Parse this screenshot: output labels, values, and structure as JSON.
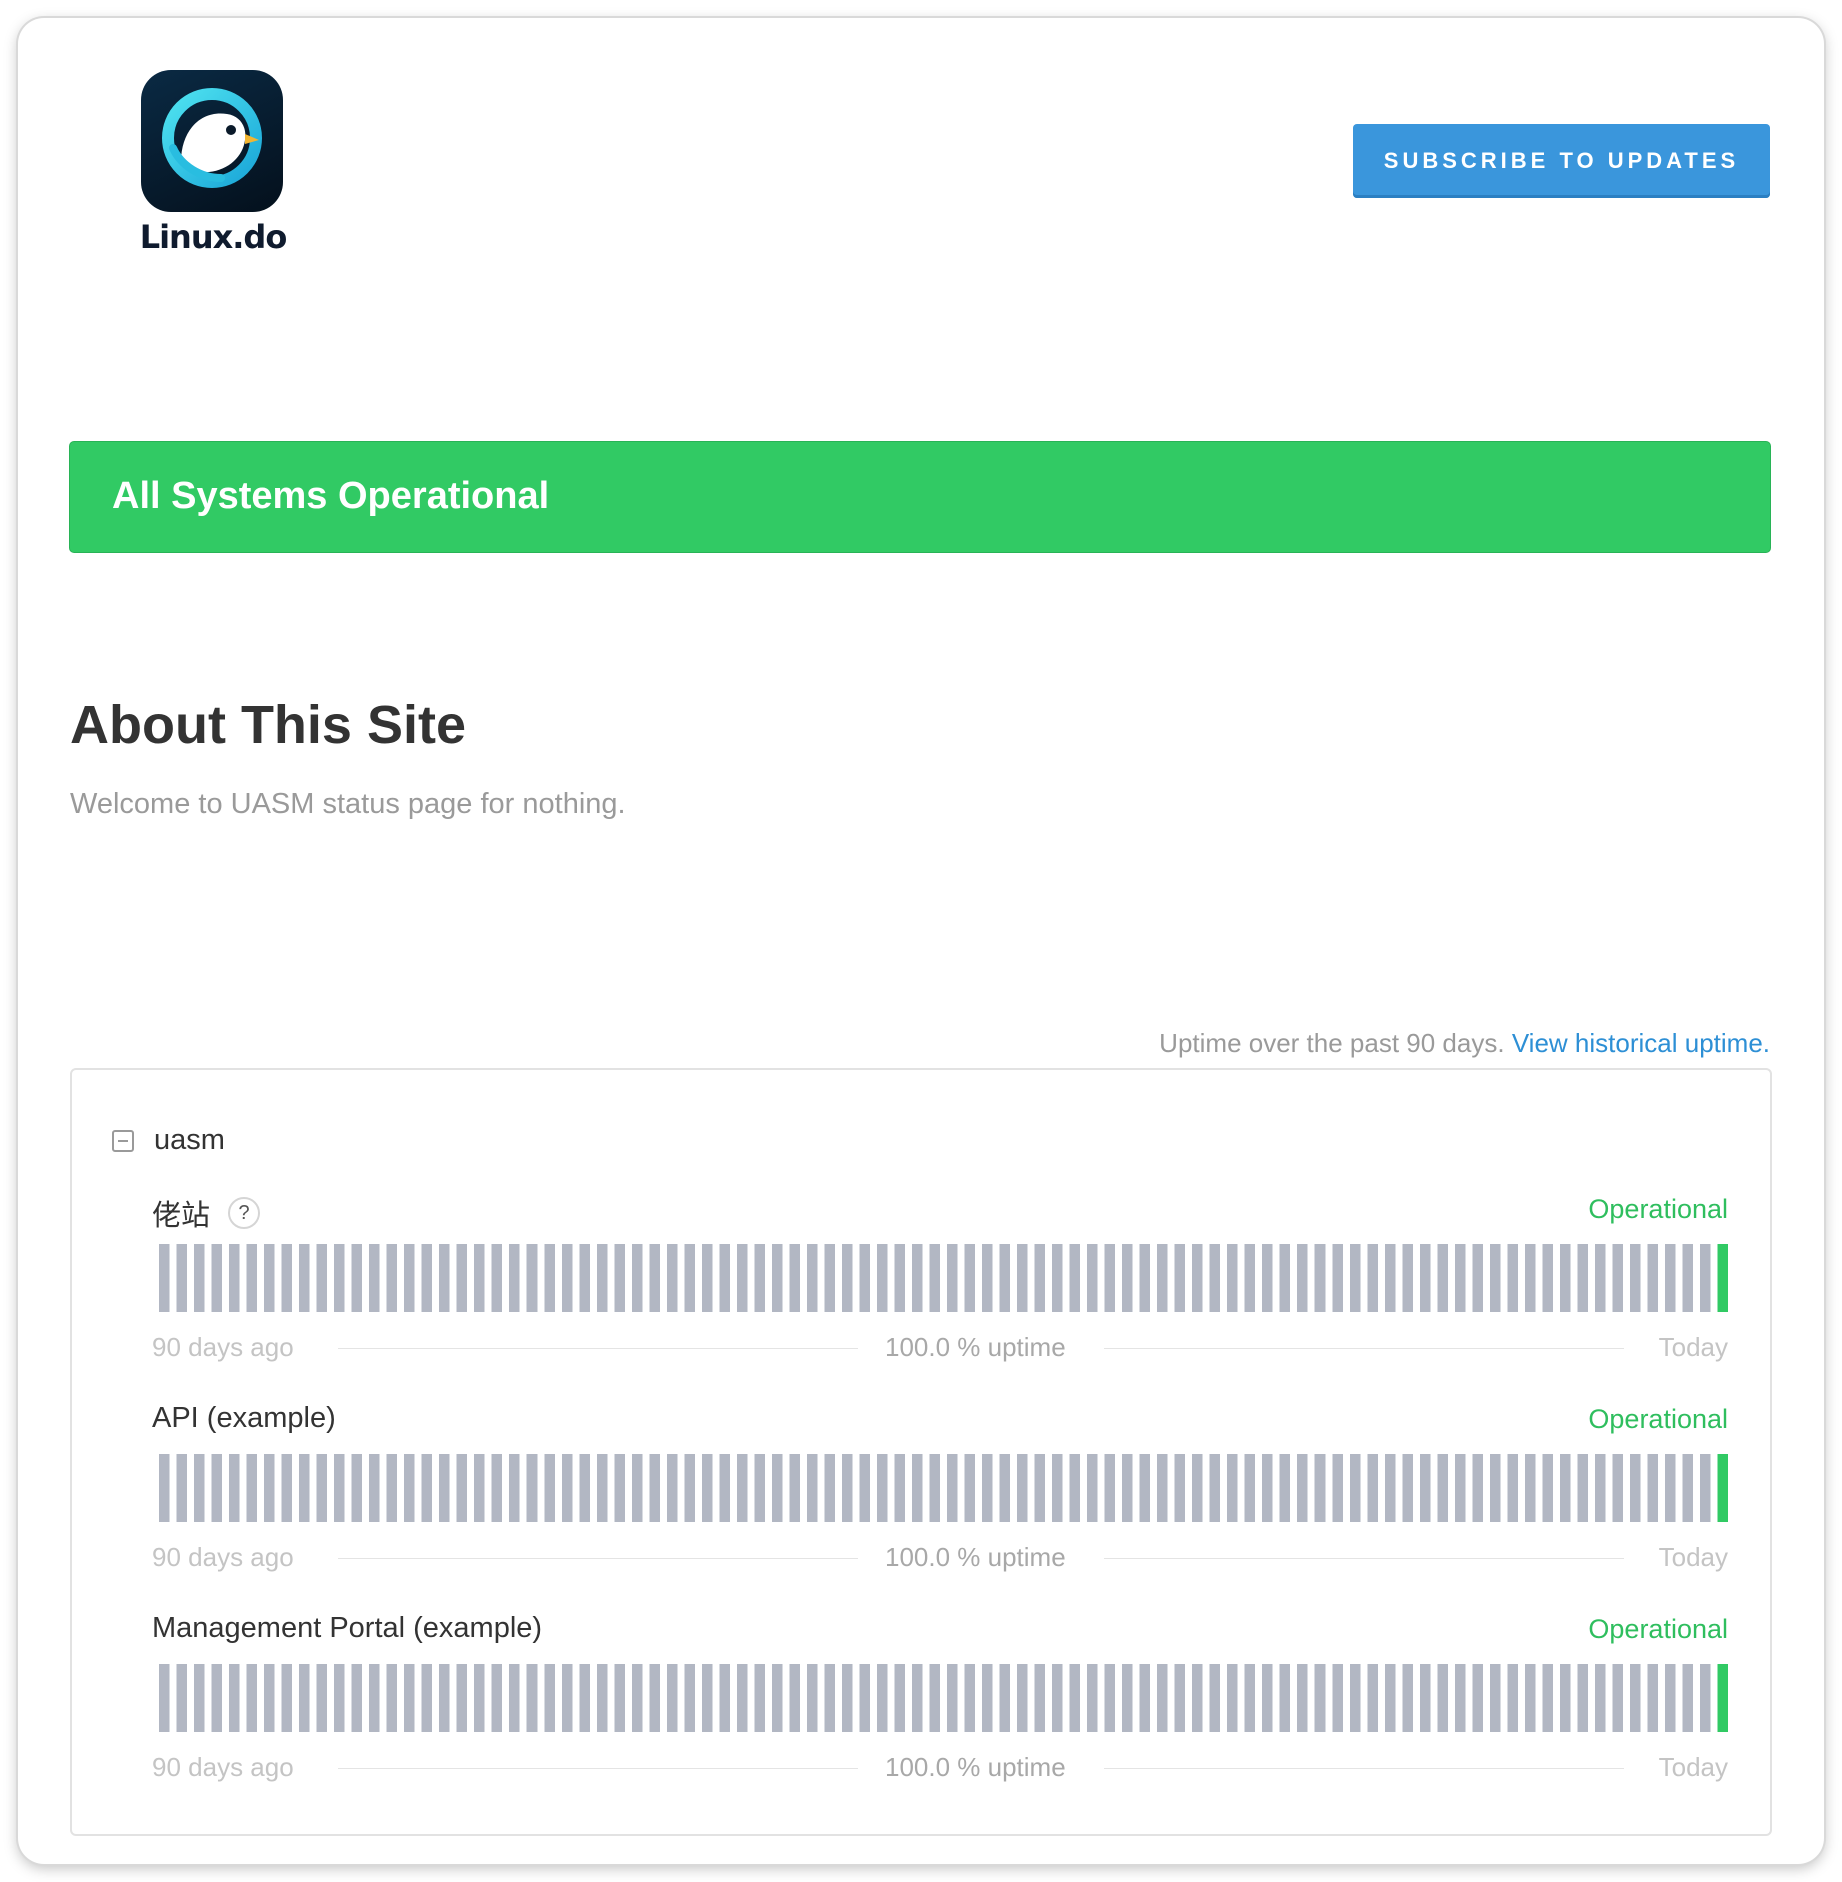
{
  "header": {
    "logo_text": "Linux.do",
    "subscribe_label": "SUBSCRIBE TO UPDATES"
  },
  "status_banner": {
    "text": "All Systems Operational",
    "color": "#31ca64"
  },
  "about": {
    "title": "About This Site",
    "description": "Welcome to UASM status page for nothing."
  },
  "uptime_caption": {
    "text": "Uptime over the past 90 days.",
    "link": "View historical uptime."
  },
  "colors": {
    "operational": "#2fbe5e",
    "bar_no_data": "#b2b7c3",
    "bar_operational": "#31ca64",
    "accent": "#3a96dc"
  },
  "group": {
    "name": "uasm",
    "components": [
      {
        "name": "佬站",
        "has_help": true,
        "status": "Operational",
        "legend_left": "90 days ago",
        "legend_mid": "100.0 % uptime",
        "legend_right": "Today",
        "bar_count": 90,
        "operational_days": 1
      },
      {
        "name": "API (example)",
        "has_help": false,
        "status": "Operational",
        "legend_left": "90 days ago",
        "legend_mid": "100.0 % uptime",
        "legend_right": "Today",
        "bar_count": 90,
        "operational_days": 1
      },
      {
        "name": "Management Portal (example)",
        "has_help": false,
        "status": "Operational",
        "legend_left": "90 days ago",
        "legend_mid": "100.0 % uptime",
        "legend_right": "Today",
        "bar_count": 90,
        "operational_days": 1
      }
    ]
  }
}
